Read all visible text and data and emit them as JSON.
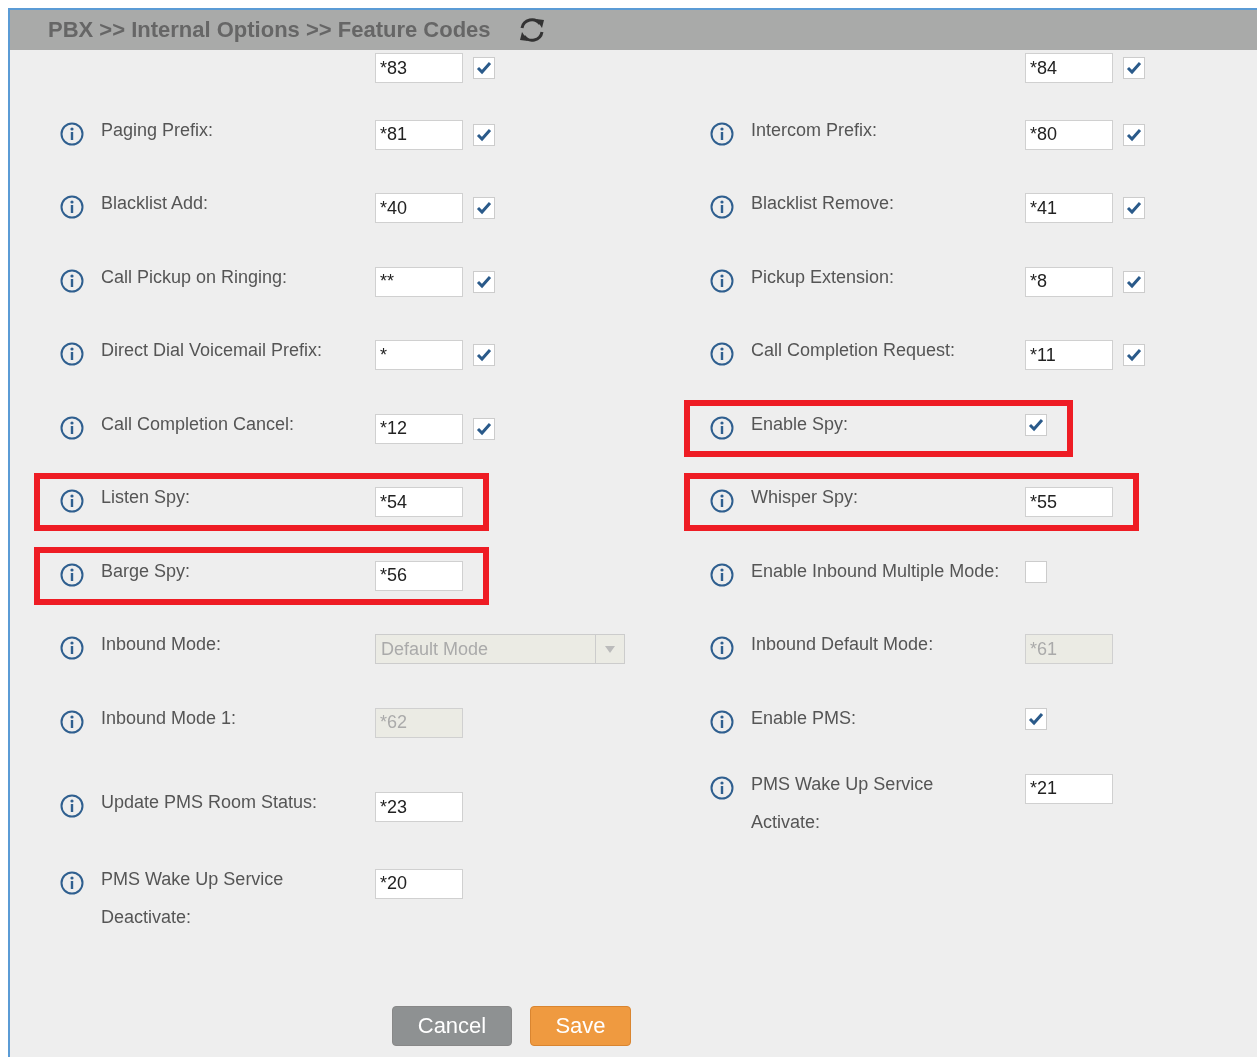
{
  "breadcrumb": "PBX >> Internal Options >> Feature Codes",
  "rows": [
    {
      "left": {
        "kind": "code",
        "value": "*83",
        "checked": true,
        "disabled": false,
        "highlighted": false
      },
      "right": {
        "kind": "code",
        "value": "*84",
        "checked": true,
        "disabled": false,
        "highlighted": false
      }
    },
    {
      "left": {
        "kind": "code",
        "label": "Paging Prefix:",
        "value": "*81",
        "checked": true,
        "disabled": false,
        "highlighted": false
      },
      "right": {
        "kind": "code",
        "label": "Intercom Prefix:",
        "value": "*80",
        "checked": true,
        "disabled": false,
        "highlighted": false
      }
    },
    {
      "left": {
        "kind": "code",
        "label": "Blacklist Add:",
        "value": "*40",
        "checked": true,
        "disabled": false,
        "highlighted": false
      },
      "right": {
        "kind": "code",
        "label": "Blacklist Remove:",
        "value": "*41",
        "checked": true,
        "disabled": false,
        "highlighted": false
      }
    },
    {
      "left": {
        "kind": "code",
        "label": "Call Pickup on Ringing:",
        "value": "**",
        "checked": true,
        "disabled": false,
        "highlighted": false
      },
      "right": {
        "kind": "code",
        "label": "Pickup Extension:",
        "value": "*8",
        "checked": true,
        "disabled": false,
        "highlighted": false
      }
    },
    {
      "left": {
        "kind": "code",
        "label": "Direct Dial Voicemail Prefix:",
        "value": "*",
        "checked": true,
        "disabled": false,
        "highlighted": false
      },
      "right": {
        "kind": "code",
        "label": "Call Completion Request:",
        "value": "*11",
        "checked": true,
        "disabled": false,
        "highlighted": false
      }
    },
    {
      "left": {
        "kind": "code",
        "label": "Call Completion Cancel:",
        "value": "*12",
        "checked": true,
        "disabled": false,
        "highlighted": false
      },
      "right": {
        "kind": "checkbox",
        "label": "Enable Spy:",
        "checked": true,
        "highlighted": true
      }
    },
    {
      "left": {
        "kind": "input",
        "label": "Listen Spy:",
        "value": "*54",
        "disabled": false,
        "highlighted": true
      },
      "right": {
        "kind": "input",
        "label": "Whisper Spy:",
        "value": "*55",
        "disabled": false,
        "highlighted": true
      }
    },
    {
      "left": {
        "kind": "input",
        "label": "Barge Spy:",
        "value": "*56",
        "disabled": false,
        "highlighted": true
      },
      "right": {
        "kind": "checkbox",
        "label": "Enable Inbound Multiple Mode:",
        "checked": false,
        "highlighted": false
      }
    },
    {
      "left": {
        "kind": "select",
        "label": "Inbound Mode:",
        "value": "Default Mode",
        "disabled": true,
        "highlighted": false
      },
      "right": {
        "kind": "input",
        "label": "Inbound Default Mode:",
        "value": "*61",
        "disabled": true,
        "highlighted": false
      }
    },
    {
      "left": {
        "kind": "input",
        "label": "Inbound Mode 1:",
        "value": "*62",
        "disabled": true,
        "highlighted": false
      },
      "right": {
        "kind": "checkbox",
        "label": "Enable PMS:",
        "checked": true,
        "highlighted": false
      }
    },
    {
      "left": {
        "kind": "input",
        "label": "Update PMS Room Status:",
        "value": "*23",
        "disabled": false,
        "highlighted": false
      },
      "right": {
        "kind": "input",
        "label": "PMS Wake Up Service\nActivate:",
        "value": "*21",
        "disabled": false,
        "highlighted": false
      }
    },
    {
      "left": {
        "kind": "input",
        "label": "PMS Wake Up Service\nDeactivate:",
        "value": "*20",
        "disabled": false,
        "highlighted": false
      }
    }
  ],
  "buttons": [
    {
      "label": "Cancel",
      "kind": "secondary"
    },
    {
      "label": "Save",
      "kind": "primary"
    }
  ]
}
